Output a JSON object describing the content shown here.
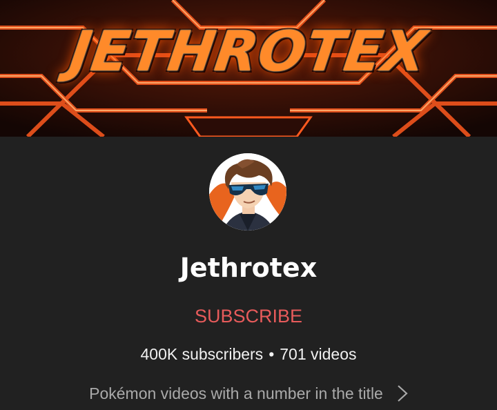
{
  "banner": {
    "title": "JETHROTEX",
    "accent_color": "#ff5a1f",
    "glow_color": "#ffb070"
  },
  "channel": {
    "avatar_icon": "avatar-sunglasses-character",
    "name": "Jethrotex",
    "subscribe_label": "SUBSCRIBE",
    "subscribe_color": "#e85b5b",
    "subscribers": "400K subscribers",
    "separator": "•",
    "videos": "701 videos",
    "description": "Pokémon videos with a number in the title",
    "more_icon": "chevron-right-icon"
  }
}
